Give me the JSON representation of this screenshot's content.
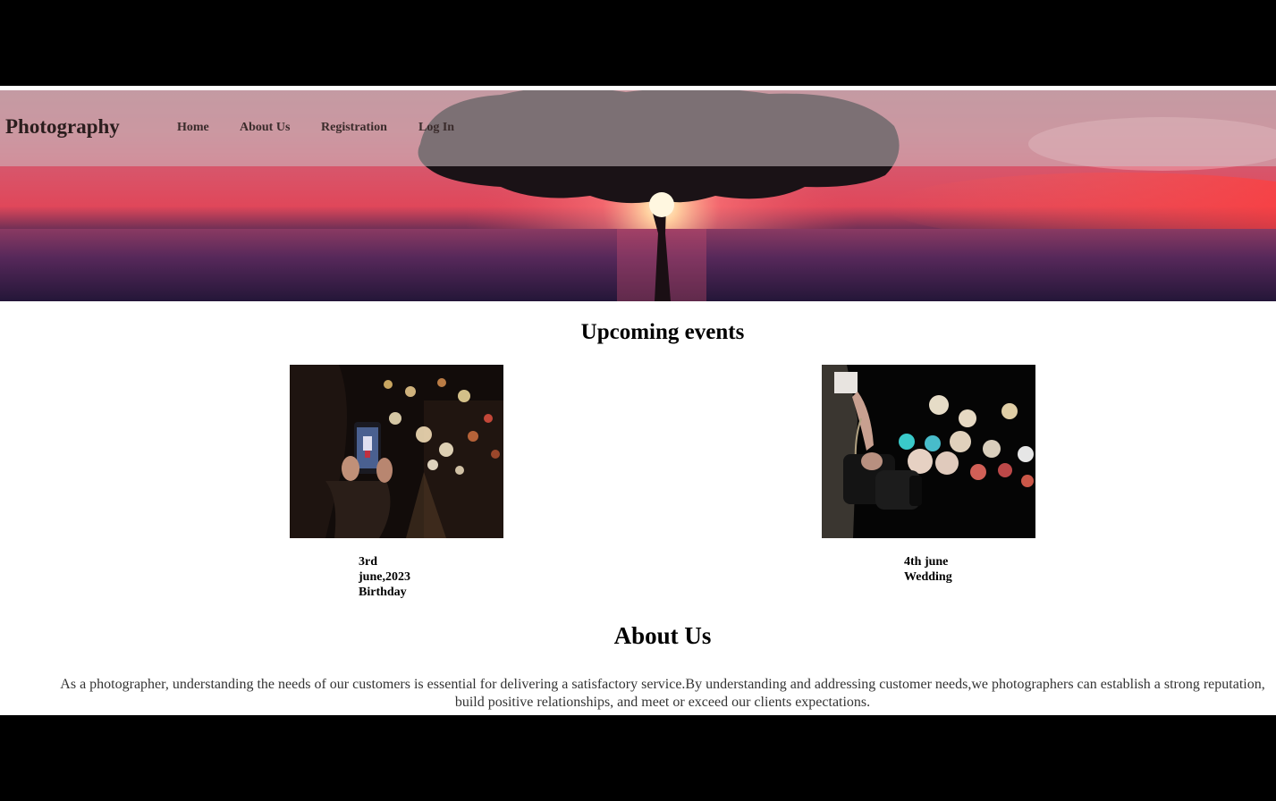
{
  "brand": "Photography",
  "nav": {
    "home": "Home",
    "about": "About Us",
    "registration": "Registration",
    "login": "Log In"
  },
  "events": {
    "title": "Upcoming events",
    "items": [
      {
        "date": "3rd june,2023",
        "name": "Birthday"
      },
      {
        "date": "4th june",
        "name": "Wedding"
      }
    ]
  },
  "about": {
    "title": "About Us",
    "text": "As a photographer, understanding the needs of our customers is essential for delivering a satisfactory service.By understanding and addressing customer needs,we photographers can establish a strong reputation, build positive relationships, and meet or exceed our clients expectations."
  },
  "colors": {
    "page_background": "#000000",
    "content_background": "#ffffff",
    "sunset_red": "#e0475a"
  }
}
